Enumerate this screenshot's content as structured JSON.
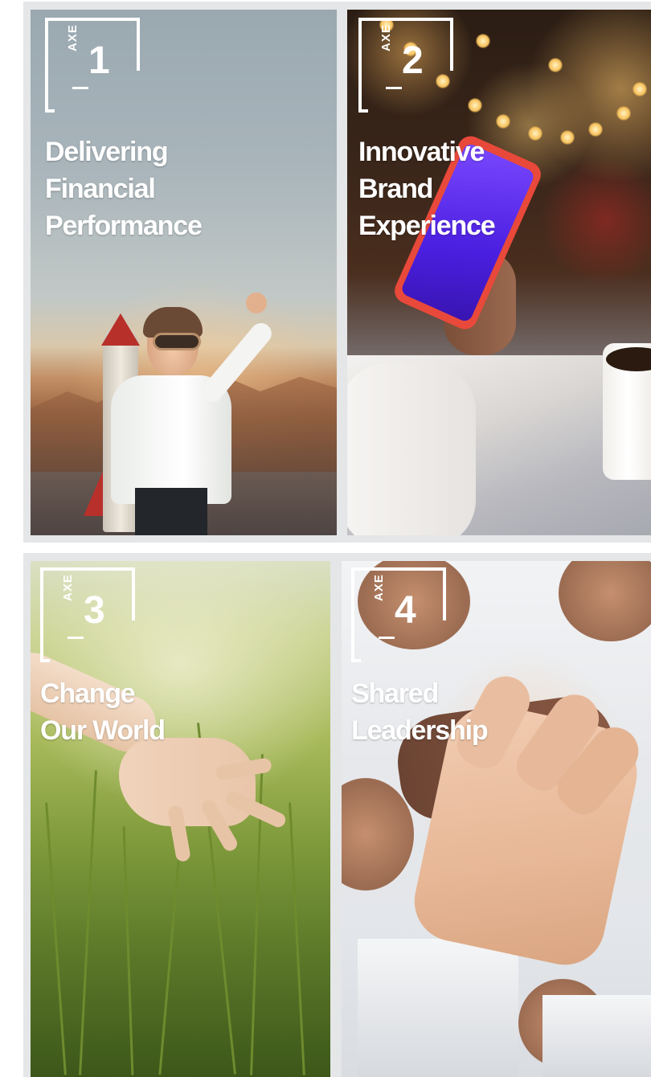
{
  "cards": [
    {
      "brand": "AXE",
      "number": "1",
      "title": "Delivering\nFinancial\nPerformance"
    },
    {
      "brand": "AXE",
      "number": "2",
      "title": "Innovative\nBrand\nExperience"
    },
    {
      "brand": "AXE",
      "number": "3",
      "title": "Change\nOur World"
    },
    {
      "brand": "AXE",
      "number": "4",
      "title": "Shared\nLeadership"
    }
  ],
  "colors": {
    "text": "#ffffff",
    "panel_bg": "#e4e6e7"
  }
}
